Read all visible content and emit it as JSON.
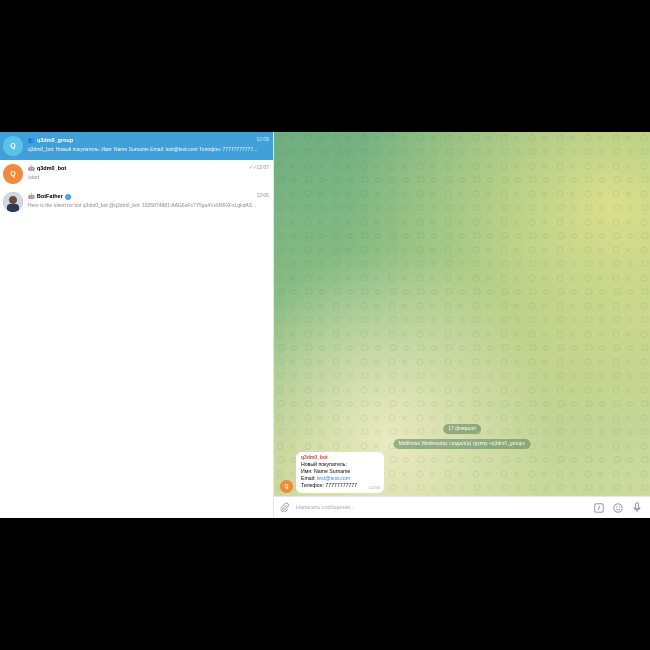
{
  "chats": [
    {
      "title": "q3dm0_group",
      "glyph": "👥",
      "preview": "q3dm0_bot: Новый покупатель: Имя: Name Surname Email: test@test.com Телефон: 77777777777...",
      "time": "12:08",
      "avatar_letter": "Q",
      "avatar_color": "#5bc2e8",
      "active": true
    },
    {
      "title": "q3dm0_bot",
      "glyph": "🤖",
      "preview": "/start",
      "time": "12:07",
      "avatar_letter": "Q",
      "avatar_color": "#f08b3c",
      "active": false,
      "ticks": "✓✓"
    },
    {
      "title": "BotFather",
      "glyph": "🤖",
      "preview": "Here is the token for bot q3dm0_bot @q3dm0_bot: 1825874881:AAG6eFs7Y5gu4Vs6RBXFsLgkdAS...",
      "time": "12:05",
      "active": false,
      "verified": true
    }
  ],
  "main": {
    "date_pill": "17 февраля",
    "service_msg": "Matthews Wednesday создал(а) группу «q3dm0_group»",
    "message": {
      "avatar_letter": "Q",
      "sender": "q3dm0_bot",
      "line1": "Новый покупатель:",
      "line2": "Имя: Name Surname",
      "email_label": "Email: ",
      "email": "test@test.com",
      "line4": "Телефон: 77777777777",
      "time": "12:08"
    },
    "composer_placeholder": "Написать сообщение..."
  },
  "colors": {
    "accent": "#419fd9",
    "sender": "#d4463d",
    "link": "#3a88c6"
  }
}
